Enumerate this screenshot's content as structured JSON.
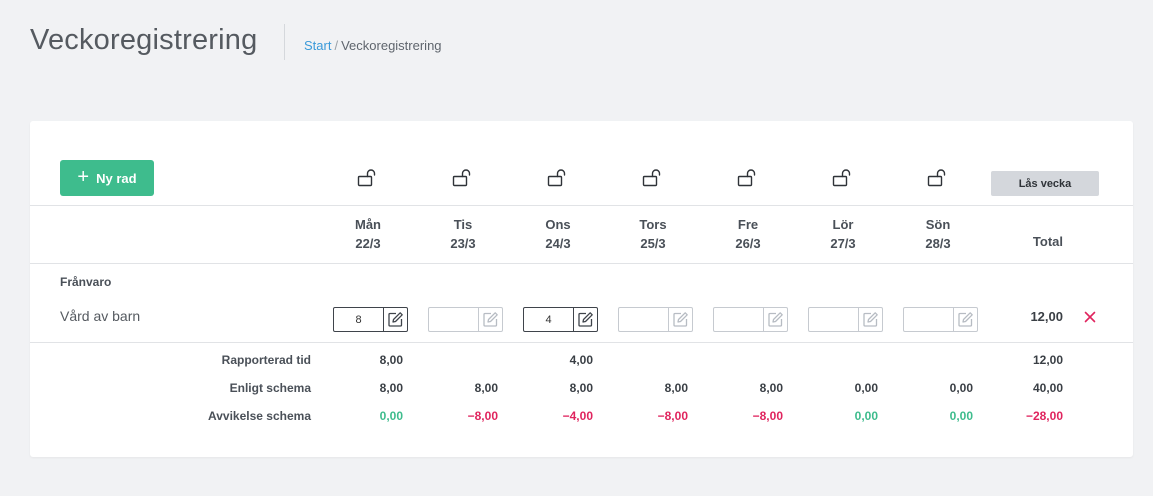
{
  "page": {
    "title": "Veckoregistrering",
    "breadcrumb": {
      "home": "Start",
      "separator": "/",
      "current": "Veckoregistrering"
    }
  },
  "toolbar": {
    "new_row_icon": "+",
    "new_row_label": "Ny rad",
    "lock_week_label": "Lås vecka",
    "lock_icon": "unlocked-padlock-icon"
  },
  "days": [
    {
      "name": "Mån",
      "date": "22/3"
    },
    {
      "name": "Tis",
      "date": "23/3"
    },
    {
      "name": "Ons",
      "date": "24/3"
    },
    {
      "name": "Tors",
      "date": "25/3"
    },
    {
      "name": "Fre",
      "date": "26/3"
    },
    {
      "name": "Lör",
      "date": "27/3"
    },
    {
      "name": "Sön",
      "date": "28/3"
    }
  ],
  "total_header": "Total",
  "group": {
    "label": "Frånvaro",
    "rows": [
      {
        "label": "Vård av barn",
        "values": [
          "8",
          "",
          "4",
          "",
          "",
          "",
          ""
        ],
        "total": "12,00",
        "delete_icon": "×"
      }
    ]
  },
  "summary": [
    {
      "label": "Rapporterad tid",
      "values": [
        "8,00",
        "",
        "4,00",
        "",
        "",
        "",
        ""
      ],
      "total": "12,00"
    },
    {
      "label": "Enligt schema",
      "values": [
        "8,00",
        "8,00",
        "8,00",
        "8,00",
        "8,00",
        "0,00",
        "0,00"
      ],
      "total": "40,00"
    },
    {
      "label": "Avvikelse schema",
      "values": [
        "0,00",
        "−8,00",
        "−4,00",
        "−8,00",
        "−8,00",
        "0,00",
        "0,00"
      ],
      "total": "−28,00"
    }
  ],
  "colors": {
    "accent": "#3ebc8d",
    "link": "#3a9ad9",
    "negative": "#e0245e",
    "background": "#f1f2f4"
  }
}
